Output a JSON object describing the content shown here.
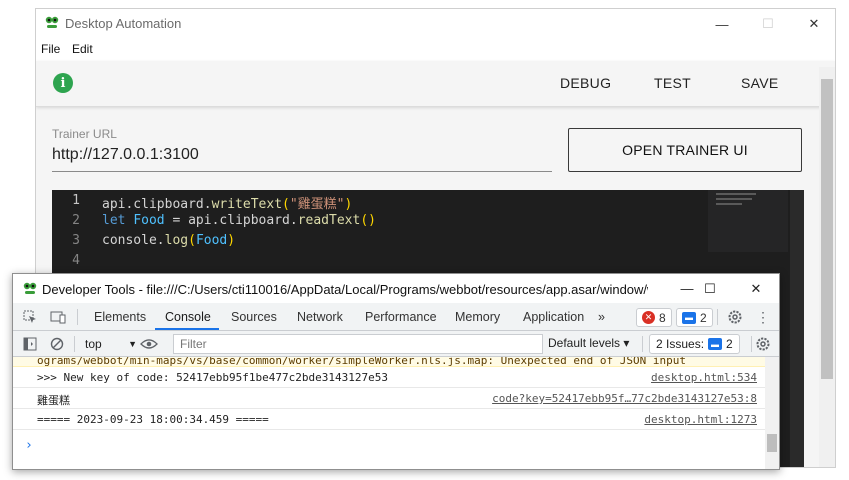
{
  "app": {
    "title": "Desktop Automation",
    "menu": [
      "File",
      "Edit"
    ],
    "toolbar": {
      "debug": "DEBUG",
      "test": "TEST",
      "save": "SAVE",
      "status": "i"
    },
    "trainer_url_label": "Trainer URL",
    "trainer_url_value": "http://127.0.0.1:3100",
    "open_trainer_button": "OPEN TRAINER UI",
    "editor": {
      "line_numbers": [
        "1",
        "2",
        "3",
        "4"
      ],
      "line1": {
        "obj": "api.clipboard.",
        "fn": "writeText",
        "p1": "(",
        "str": "\"雞蛋糕\"",
        "p2": ")"
      },
      "line2": {
        "kw": "let",
        "var": "Food",
        "eq": " = api.clipboard.",
        "fn": "readText",
        "p": "()"
      },
      "line3": {
        "obj": "console.",
        "fn": "log",
        "p1": "(",
        "var": "Food",
        "p2": ")"
      }
    }
  },
  "devtools": {
    "title": "Developer Tools - file:///C:/Users/cti110016/AppData/Local/Programs/webbot/resources/app.asar/window/wap...",
    "tabs": [
      "Elements",
      "Console",
      "Sources",
      "Network",
      "Performance",
      "Memory",
      "Application"
    ],
    "active_tab": "Console",
    "more": "»",
    "error_count": "8",
    "info_count": "2",
    "context": "top",
    "filter_placeholder": "Filter",
    "levels": "Default levels ▾",
    "issues_label": "2 Issues:",
    "issues_count": "2",
    "messages": [
      {
        "text": "ograms/webbot/min-maps/vs/base/common/worker/simpleWorker.nls.js.map: Unexpected end of JSON input",
        "source": ""
      },
      {
        "text": ">>> New key of code: 52417ebb95f1be477c2bde3143127e53",
        "source": "desktop.html:534"
      },
      {
        "text": "雞蛋糕",
        "source": "code?key=52417ebb95f…77c2bde3143127e53:8"
      },
      {
        "text": "===== 2023-09-23 18:00:34.459 =====",
        "source": "desktop.html:1273"
      }
    ],
    "prompt": "›"
  },
  "colors": {
    "status_green": "#2ea44f",
    "accent_blue": "#1a73e8",
    "error_red": "#d93025",
    "editor_bg": "#1e1e1e"
  },
  "icons": [
    "app-logo-icon",
    "info-icon",
    "minimize-icon",
    "maximize-icon",
    "close-icon",
    "inspect-icon",
    "device-toolbar-icon",
    "sidebar-icon",
    "clear-console-icon",
    "eye-icon",
    "gear-icon",
    "kebab-menu-icon"
  ]
}
